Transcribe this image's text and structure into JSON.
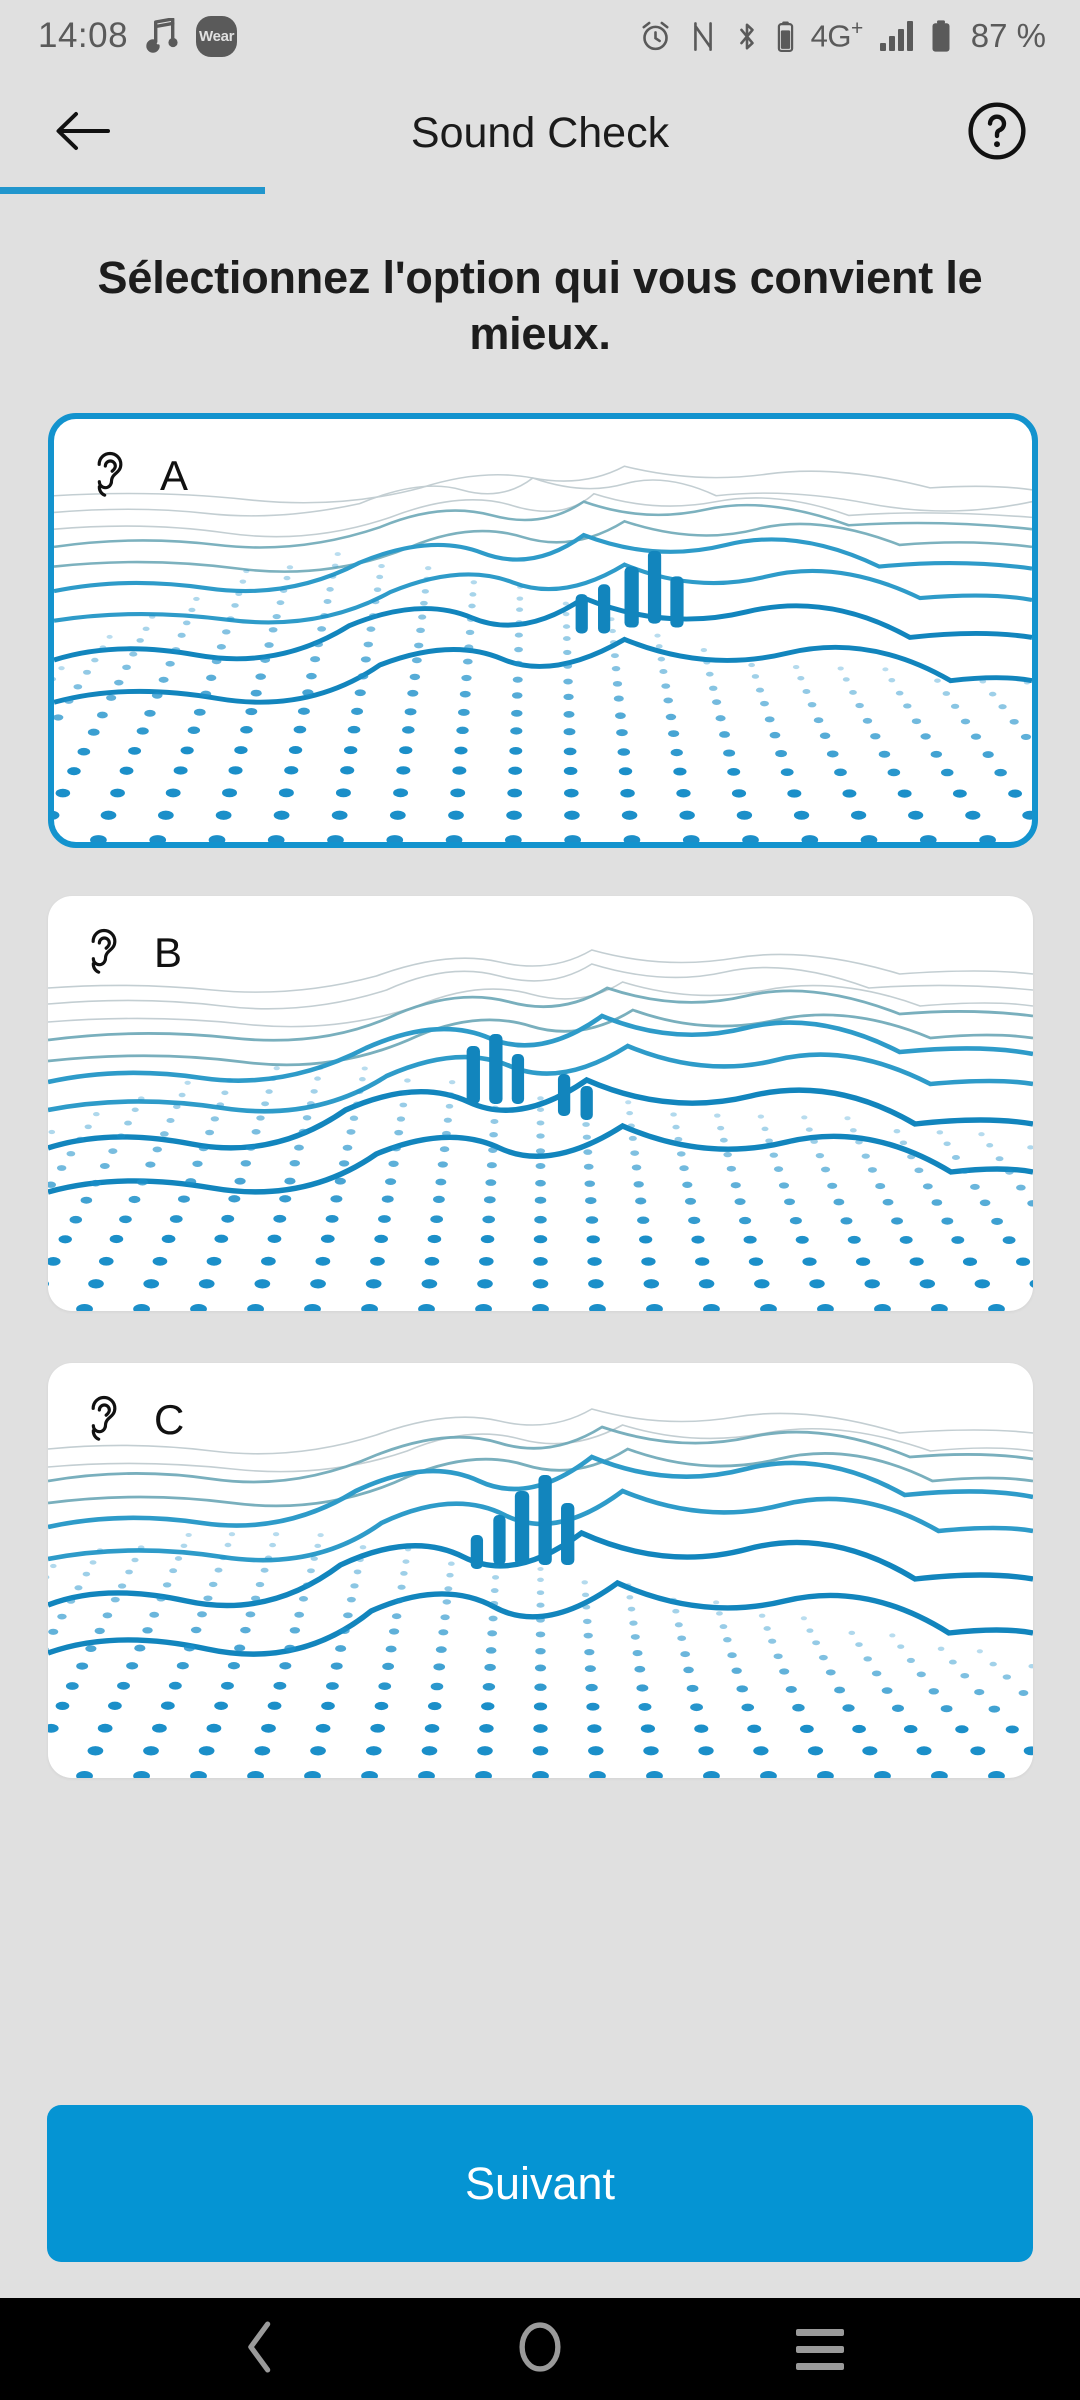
{
  "status_bar": {
    "time": "14:08",
    "icons_left": [
      "music-note-icon",
      "wear-badge-icon"
    ],
    "wear_label": "Wear",
    "network_label": "4G",
    "network_sup": "+",
    "battery_percent": "87 %",
    "icons_right": [
      "alarm-icon",
      "nfc-icon",
      "bluetooth-icon",
      "bluetooth-battery-icon",
      "signal-bars-icon",
      "battery-icon"
    ],
    "icon_color": "#5a5a5a"
  },
  "app_bar": {
    "title": "Sound Check",
    "back_icon": "arrow-left-icon",
    "help_icon": "question-circle-icon",
    "progress_percent": 24.5,
    "progress_color": "#2196cd"
  },
  "instruction": "Sélectionnez l'option qui vous convient le mieux.",
  "options": [
    {
      "id": "A",
      "letter": "A",
      "icon": "ear-icon",
      "selected": true
    },
    {
      "id": "B",
      "letter": "B",
      "icon": "ear-icon",
      "selected": false
    },
    {
      "id": "C",
      "letter": "C",
      "icon": "ear-icon",
      "selected": false
    }
  ],
  "next_button": {
    "label": "Suivant",
    "color": "#0594d3",
    "text_color": "#ffffff"
  },
  "nav_bar": {
    "back_icon": "chevron-left-icon",
    "home_icon": "circle-icon",
    "recents_icon": "menu-lines-icon",
    "icon_color": "#9a9a9a",
    "background": "#000000"
  },
  "theme": {
    "page_background": "#e0e0e0",
    "card_background": "#ffffff",
    "accent_blue": "#1393ce",
    "viz_blue": "#1b8fc9",
    "viz_teal": "#58a6b4"
  }
}
